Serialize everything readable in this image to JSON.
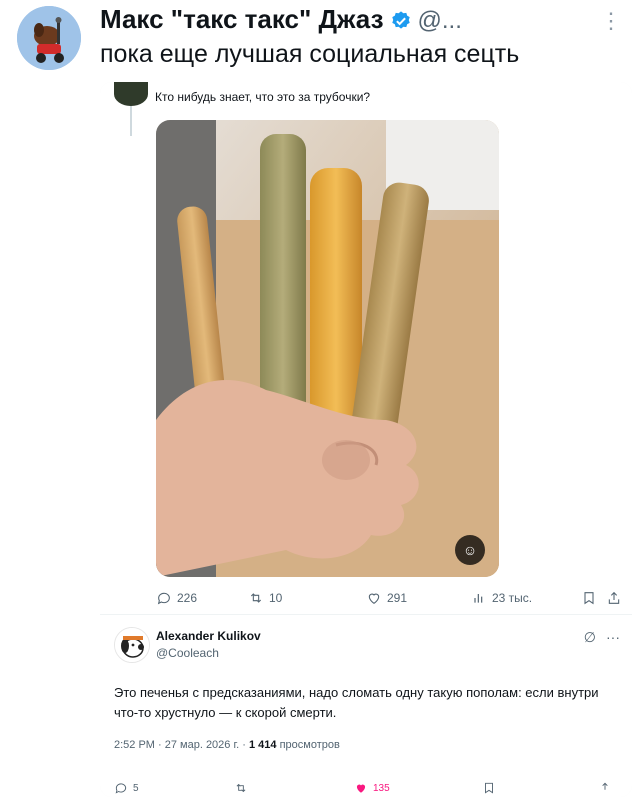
{
  "outer_post": {
    "author_name": "Макс \"такс такс\" Джаз",
    "handle": "@...",
    "text": "пока еще лучшая социальная сецть",
    "more_icon": "vertical-dots-icon",
    "verified_icon": "verified-badge-icon",
    "verified_color": "#1d9bf0"
  },
  "quoted_post": {
    "text": "Кто нибудь знает, что это за трубочки?",
    "actions": {
      "replies": "226",
      "reposts": "10",
      "likes": "291",
      "views": "23 тыс."
    }
  },
  "reply": {
    "author_name": "Alexander Kulikov",
    "handle": "@Cooleach",
    "text": "Это печенья с предсказаниями, надо сломать одну такую пополам: если внутри что-то хрустнуло — к скорой смерти.",
    "meta_prefix": "2:52 PM · 27 мар. 2026 г. · ",
    "views_count": "1 414",
    "views_label": "просмотров",
    "bottom_actions": {
      "replies": "5",
      "likes": "135"
    },
    "like_color": "#f91880"
  }
}
